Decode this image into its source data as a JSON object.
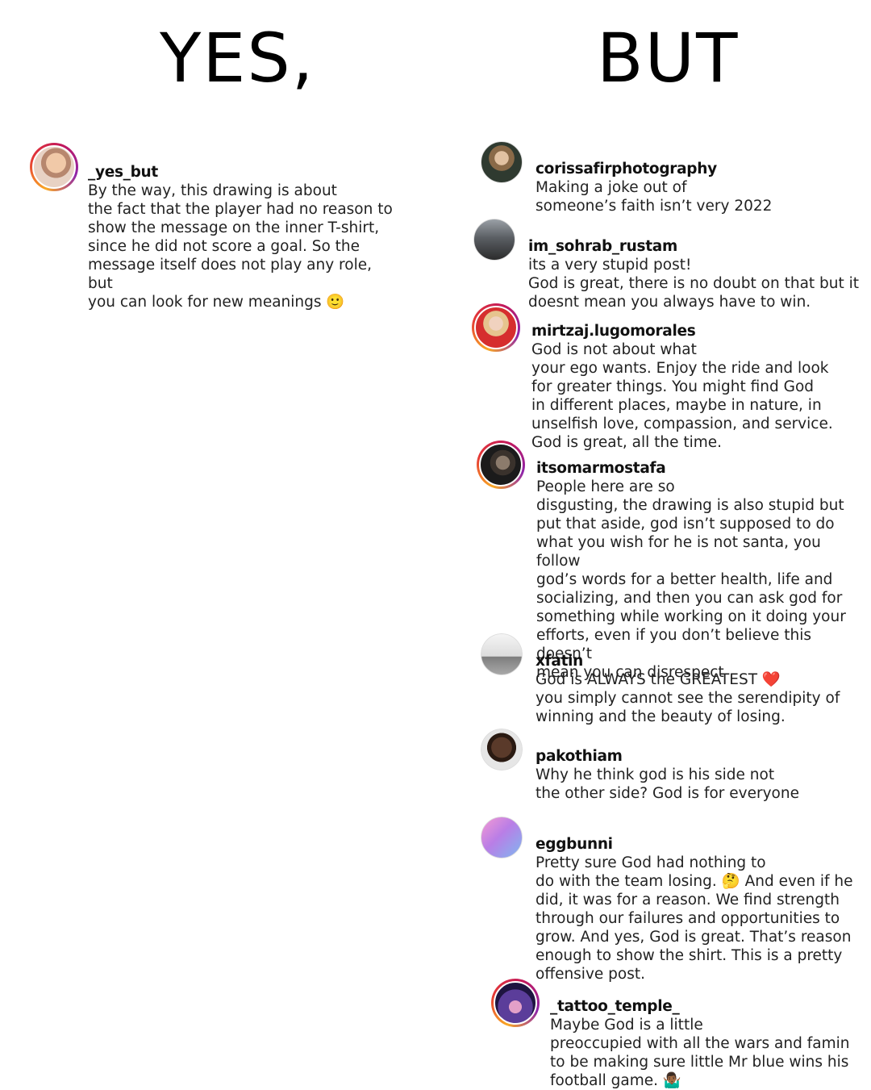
{
  "headings": {
    "left": "YES,",
    "right": "BUT"
  },
  "comments": [
    {
      "user": "_yes_but",
      "text": "By the way, this drawing is about\nthe fact that the player had no reason to\nshow the message on the inner T-shirt,\nsince he did not score a goal. So the\nmessage itself does not play any role, but\nyou can look for new meanings 🙂",
      "avatar_color": "#e9c7b2"
    },
    {
      "user": "corissafirphotography",
      "text": "Making a joke out of\nsomeone’s faith isn’t very 2022",
      "avatar_color": "#7a6a55"
    },
    {
      "user": "im_sohrab_rustam",
      "text": "its a very stupid post!\nGod is great, there is no doubt on that but it\ndoesnt mean you always have to win.",
      "avatar_color": "#6d6d6d"
    },
    {
      "user": "mirtzaj.lugomorales",
      "text": "God is not about what\nyour ego wants. Enjoy the ride and look\nfor greater things. You might find God\nin different places, maybe in nature, in\nunselfish love, compassion, and service.\nGod is great, all the time.",
      "avatar_color": "#d9a58a"
    },
    {
      "user": "itsomarmostafa",
      "text": "People here are so\ndisgusting, the drawing is also stupid but\nput that aside, god isn’t supposed to do\nwhat you wish for he is not santa, you follow\ngod’s words for a better health, life and\nsocializing, and then you can ask god for\nsomething while working on it doing your\nefforts, even if you don’t believe this doesn’t\nmean you can disrespect",
      "avatar_color": "#3a3a3a"
    },
    {
      "user": "xfatin",
      "text": "God is ALWAYS the GREATEST ❤️\nyou simply cannot see the serendipity of\nwinning and the beauty of losing.",
      "avatar_color": "#d8d8d8"
    },
    {
      "user": "pakothiam",
      "text": "Why he think god is his side not\nthe other side?  God is for everyone",
      "avatar_color": "#4a2e22"
    },
    {
      "user": "eggbunni",
      "text": "Pretty sure God had nothing to\ndo with the team losing. 🤔 And even if he\ndid, it was for a reason. We find strength\nthrough our failures and opportunities to\ngrow. And yes, God is great. That’s reason\nenough to show the shirt. This is a pretty\noffensive post.",
      "avatar_color": "#c58be0"
    },
    {
      "user": "_tattoo_temple_",
      "text": "Maybe God is a little\npreoccupied with all the wars and famin\nto be making sure little Mr blue wins his\nfootball game. 🤷🏾‍♂️",
      "avatar_color": "#3b2a6e"
    }
  ]
}
